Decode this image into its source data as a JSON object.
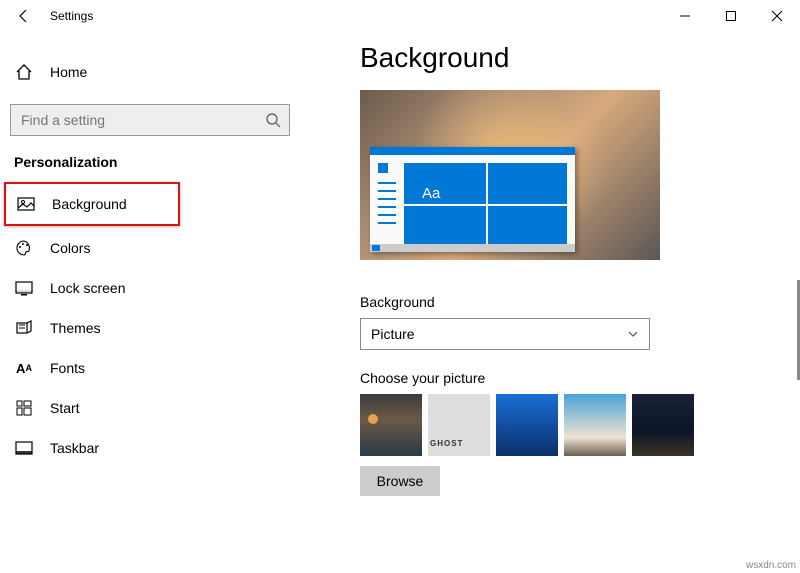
{
  "window": {
    "title": "Settings"
  },
  "sidebar": {
    "home_label": "Home",
    "search_placeholder": "Find a setting",
    "section": "Personalization",
    "items": [
      {
        "label": "Background",
        "icon": "picture-icon",
        "selected": true
      },
      {
        "label": "Colors",
        "icon": "palette-icon"
      },
      {
        "label": "Lock screen",
        "icon": "lockscreen-icon"
      },
      {
        "label": "Themes",
        "icon": "themes-icon"
      },
      {
        "label": "Fonts",
        "icon": "fonts-icon"
      },
      {
        "label": "Start",
        "icon": "start-icon"
      },
      {
        "label": "Taskbar",
        "icon": "taskbar-icon"
      }
    ]
  },
  "main": {
    "page_title": "Background",
    "preview_text": "Aa",
    "background_label": "Background",
    "background_value": "Picture",
    "choose_label": "Choose your picture",
    "browse_label": "Browse"
  },
  "watermark": "wsxdn.com"
}
